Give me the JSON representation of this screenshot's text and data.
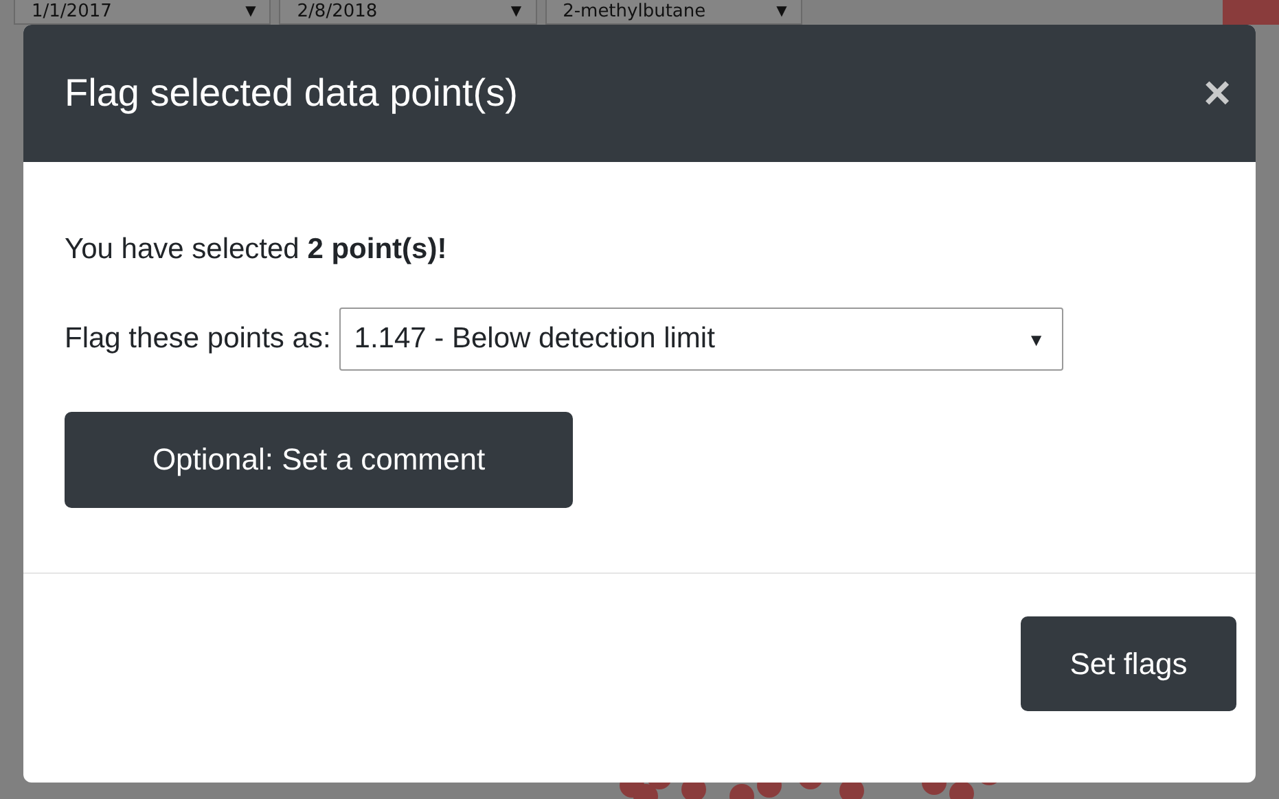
{
  "background": {
    "filters": [
      {
        "kind": "select",
        "value": "1/1/2017",
        "caret": "▼"
      },
      {
        "kind": "select",
        "value": "2/8/2018",
        "caret": "▼"
      },
      {
        "kind": "select",
        "value": "2-methylbutane",
        "caret": "▼"
      },
      {
        "kind": "button"
      }
    ]
  },
  "modal": {
    "title": "Flag selected data point(s)",
    "close": "×",
    "message": "You have selected **2 point(s)!**",
    "flag_label": "Flag these points as:",
    "flag_select": {
      "value": "1.147 - Below detection limit",
      "caret": "▼"
    },
    "comment_button": "Optional: Set a comment",
    "submit_button": "Set flags"
  }
}
